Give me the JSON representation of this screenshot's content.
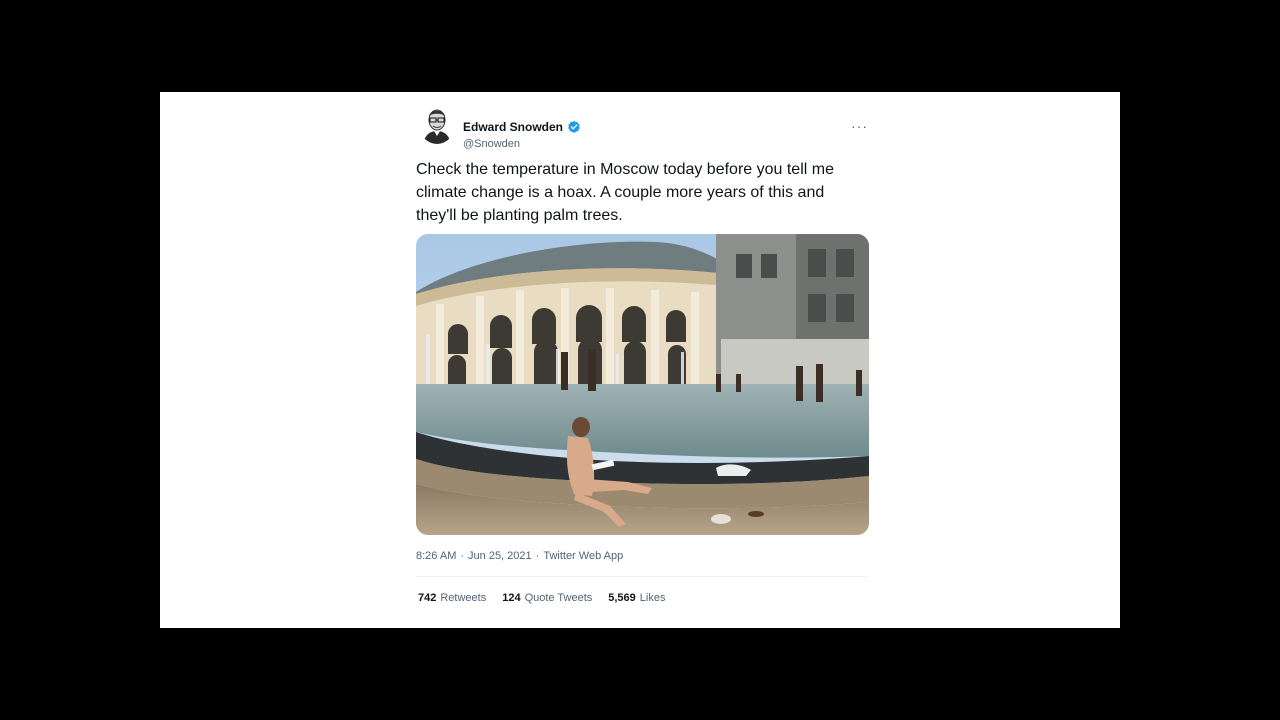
{
  "tweet": {
    "author_name": "Edward Snowden",
    "handle": "@Snowden",
    "verified": true,
    "more_label": "···",
    "text": "Check the temperature in Moscow today before you tell me climate change is a hoax. A couple more years of this and they'll be planting palm trees.",
    "time": "8:26 AM",
    "date": "Jun 25, 2021",
    "source": "Twitter Web App",
    "separator": "·",
    "stats": {
      "retweets_count": "742",
      "retweets_label": "Retweets",
      "quotes_count": "124",
      "quotes_label": "Quote Tweets",
      "likes_count": "5,569",
      "likes_label": "Likes"
    }
  },
  "colors": {
    "background_outer": "#000000",
    "card": "#ffffff",
    "verified_blue": "#1d9bf0",
    "secondary_text": "#536471"
  },
  "icons": [
    "avatar-image",
    "verified-badge-icon",
    "more-options-icon"
  ]
}
